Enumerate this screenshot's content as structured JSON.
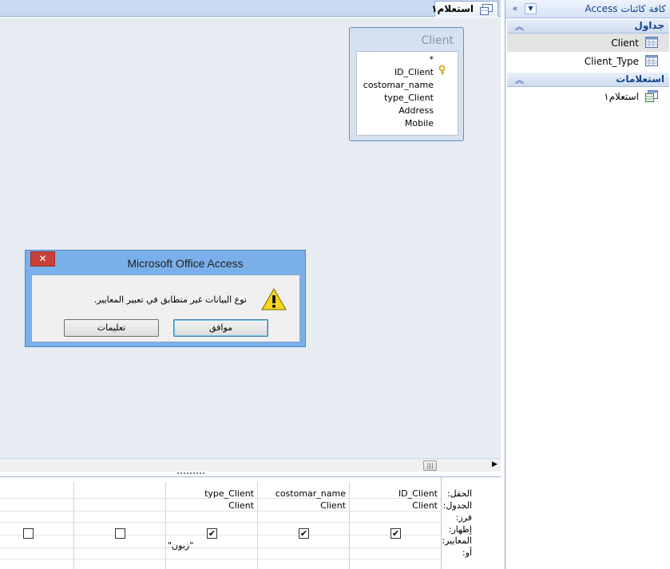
{
  "nav": {
    "title": "كافة كائنات Access",
    "groups": [
      {
        "title": "جداول",
        "items": [
          {
            "label": "Client",
            "selected": true
          },
          {
            "label": "Client_Type",
            "selected": false
          }
        ]
      },
      {
        "title": "استعلامات",
        "items": [
          {
            "label": "استعلام١",
            "selected": false
          }
        ]
      }
    ]
  },
  "document": {
    "tab_label": "استعلام١"
  },
  "table_box": {
    "title": "Client",
    "fields": [
      "*",
      "ID_Client",
      "costomar_name",
      "type_Client",
      "Address",
      "Mobile"
    ],
    "primary_key": "ID_Client"
  },
  "grid": {
    "row_labels": [
      "الحقل:",
      "الجدول:",
      "فرز:",
      "إظهار:",
      "المعايير:",
      "أو:"
    ],
    "columns": [
      {
        "field": "ID_Client",
        "table": "Client",
        "show": true,
        "criteria": ""
      },
      {
        "field": "costomar_name",
        "table": "Client",
        "show": true,
        "criteria": ""
      },
      {
        "field": "type_Client",
        "table": "Client",
        "show": true,
        "criteria": "\"زبون\""
      },
      {
        "field": "",
        "table": "",
        "show": false,
        "criteria": ""
      },
      {
        "field": "",
        "table": "",
        "show": false,
        "criteria": ""
      }
    ]
  },
  "dialog": {
    "title": "Microsoft Office Access",
    "message": "نوع البيانات غير متطابق في تعبير المعايير.",
    "ok_label": "موافق",
    "help_label": "تعليمات",
    "close_glyph": "✕"
  },
  "colors": {
    "accent": "#15428b",
    "dialog_frame": "#7ab0ea",
    "close_red": "#c9413a"
  }
}
